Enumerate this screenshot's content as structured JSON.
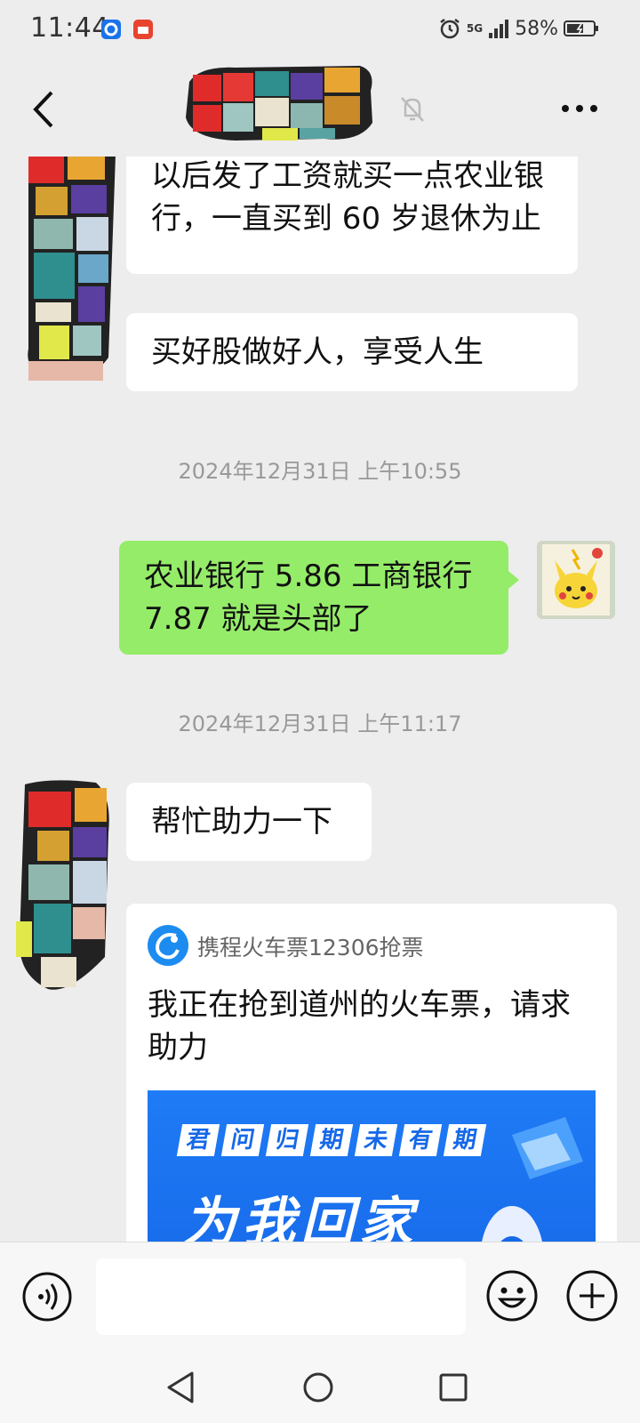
{
  "status_bar": {
    "time": "11:44",
    "battery": "58%",
    "network": "5G"
  },
  "header": {
    "title": "",
    "muted": true
  },
  "messages": [
    {
      "from": "contact",
      "text": "以后发了工资就买一点农业银行，一直买到 60 岁退休为止"
    },
    {
      "from": "contact",
      "text": "买好股做好人，享受人生"
    },
    {
      "type": "timestamp",
      "text": "2024年12月31日 上午10:55"
    },
    {
      "from": "self",
      "text": "农业银行 5.86 工商银行 7.87 就是头部了"
    },
    {
      "type": "timestamp",
      "text": "2024年12月31日 上午11:17"
    },
    {
      "from": "contact",
      "text": "帮忙助力一下"
    }
  ],
  "card": {
    "source": "携程火车票12306抢票",
    "title": "我正在抢到道州的火车票，请求助力",
    "banner_slogan": [
      "君",
      "问",
      "归",
      "期",
      "未",
      "有",
      "期"
    ],
    "banner_headline": "为我回家"
  },
  "input": {
    "value": "",
    "placeholder": ""
  },
  "colors": {
    "background": "#ededed",
    "self_bubble": "#95ec69",
    "contact_bubble": "#ffffff",
    "timestamp": "#999999",
    "banner_blue": "#1668e8"
  },
  "icons": {
    "back": "chevron-left-icon",
    "mute": "bell-off-icon",
    "more": "more-dots-icon",
    "voice": "voice-icon",
    "emoji": "smiley-icon",
    "plus": "plus-circle-icon"
  }
}
